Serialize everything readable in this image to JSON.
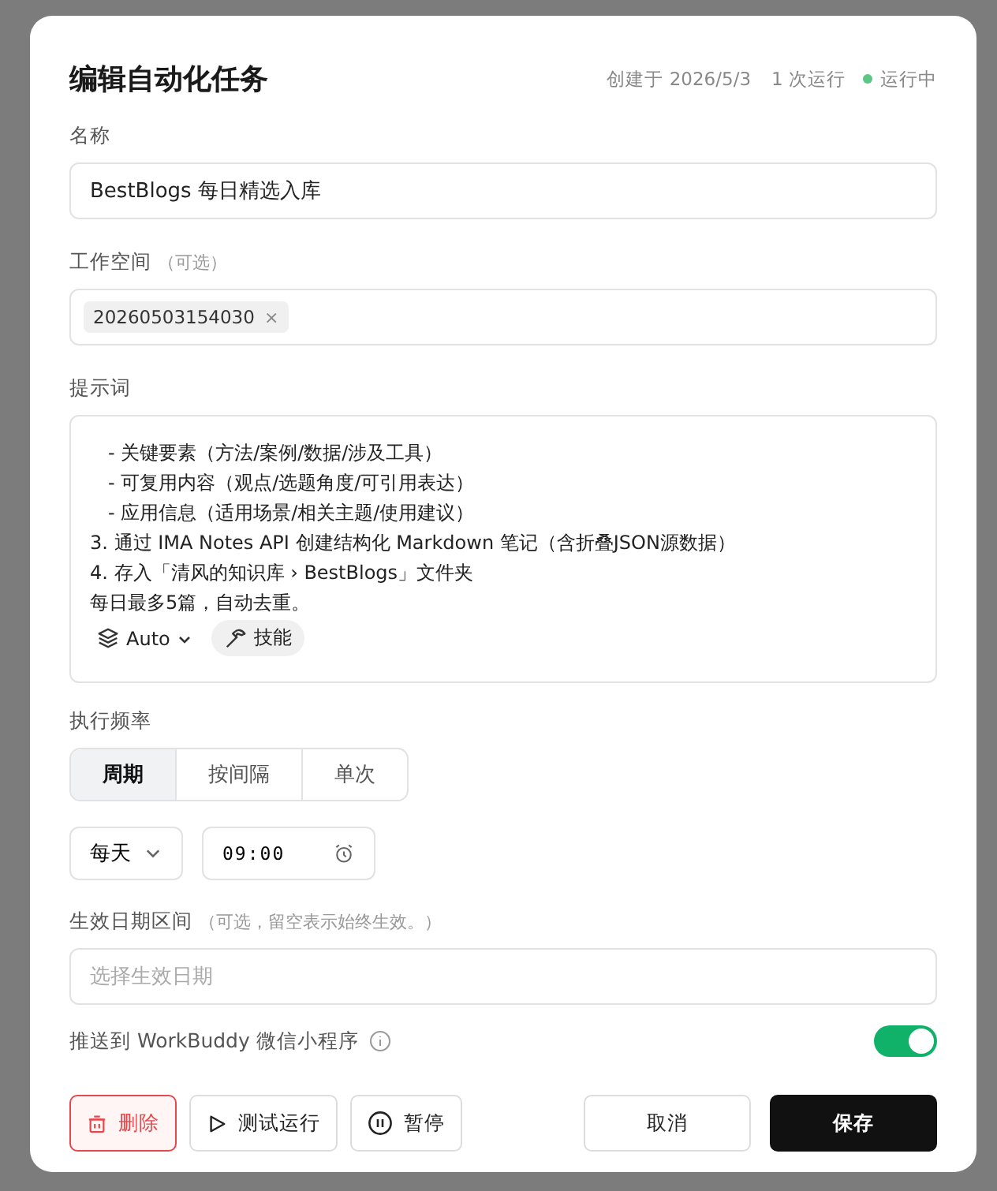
{
  "dialog": {
    "title": "编辑自动化任务",
    "created": "创建于 2026/5/3",
    "runs": "1 次运行",
    "status": {
      "label": "运行中",
      "color": "#5cc785"
    }
  },
  "name_field": {
    "label": "名称",
    "value": "BestBlogs 每日精选入库"
  },
  "workspace": {
    "label": "工作空间",
    "hint": "（可选）",
    "tags": [
      {
        "label": "20260503154030",
        "remove": "×"
      }
    ]
  },
  "prompt": {
    "label": "提示词",
    "lines": [
      "   - 关键要素（方法/案例/数据/涉及工具）",
      "   - 可复用内容（观点/选题角度/可引用表达）",
      "   - 应用信息（适用场景/相关主题/使用建议）",
      "3. 通过 IMA Notes API 创建结构化 Markdown 笔记（含折叠JSON源数据）",
      "4. 存入「清风的知识库 › BestBlogs」文件夹",
      "每日最多5篇，自动去重。"
    ],
    "model": "Auto",
    "skill": "技能"
  },
  "frequency": {
    "label": "执行频率",
    "tabs": [
      {
        "label": "周期",
        "selected": true
      },
      {
        "label": "按间隔",
        "selected": false
      },
      {
        "label": "单次",
        "selected": false
      }
    ],
    "period": "每天",
    "time": "09:00"
  },
  "date_range": {
    "label": "生效日期区间",
    "hint": "（可选，留空表示始终生效。）",
    "placeholder": "选择生效日期"
  },
  "push": {
    "label": "推送到 WorkBuddy 微信小程序",
    "on": true
  },
  "buttons": [
    {
      "kind": "delete",
      "label": "删除"
    },
    {
      "kind": "test",
      "label": "测试运行"
    },
    {
      "kind": "pause",
      "label": "暂停"
    },
    {
      "kind": "cancel",
      "label": "取消"
    },
    {
      "kind": "save",
      "label": "保存"
    }
  ]
}
